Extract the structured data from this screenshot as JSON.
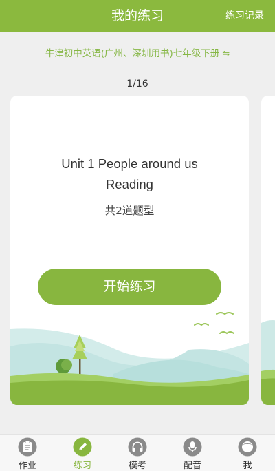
{
  "header": {
    "title": "我的练习",
    "action_label": "练习记录"
  },
  "book": {
    "name": "牛津初中英语(广州、深圳用书)七年级下册",
    "switch_icon": "swap-icon"
  },
  "pager": {
    "text": "1/16"
  },
  "card": {
    "unit_title": "Unit 1 People around us",
    "unit_subtitle": "Reading",
    "type_count": "共2道题型",
    "start_label": "开始练习"
  },
  "tabs": [
    {
      "label": "作业",
      "icon": "clipboard-icon",
      "active": false
    },
    {
      "label": "练习",
      "icon": "pencil-icon",
      "active": true
    },
    {
      "label": "模考",
      "icon": "headphones-icon",
      "active": false
    },
    {
      "label": "配音",
      "icon": "microphone-icon",
      "active": false
    },
    {
      "label": "我",
      "icon": "person-icon",
      "active": false
    }
  ],
  "colors": {
    "accent": "#88b63f",
    "header": "#8bb93e",
    "tab_inactive": "#8a8a8a"
  }
}
